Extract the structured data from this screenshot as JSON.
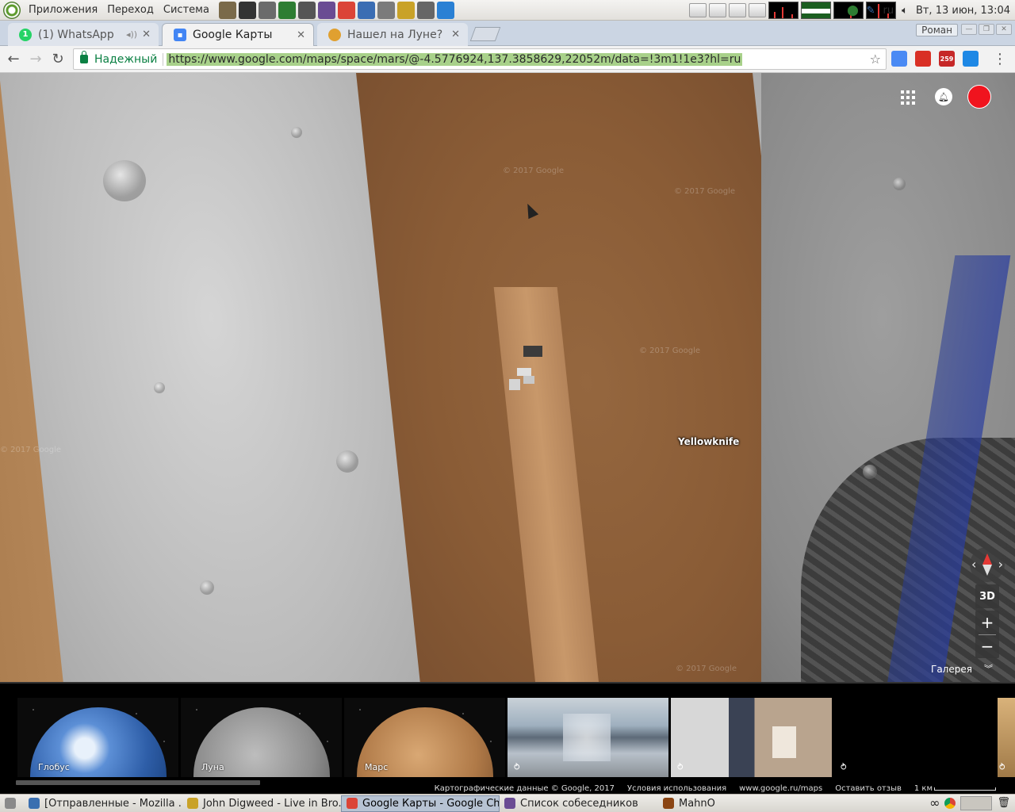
{
  "system_panel": {
    "menus": [
      "Приложения",
      "Переход",
      "Система"
    ],
    "launchers": [
      {
        "icon": "gimp-icon",
        "color": "#7a6a4a"
      },
      {
        "icon": "inkscape-icon",
        "color": "#333333"
      },
      {
        "icon": "archive-icon",
        "color": "#6b6b6b"
      },
      {
        "icon": "system-monitor-icon",
        "color": "#2e7d32"
      },
      {
        "icon": "calculator-icon",
        "color": "#555555"
      },
      {
        "icon": "pidgin-icon",
        "color": "#6a4c93"
      },
      {
        "icon": "chrome-icon",
        "color": "#db4437"
      },
      {
        "icon": "vpn-icon",
        "color": "#3b6db3"
      },
      {
        "icon": "tray-app-icon",
        "color": "#7b7b7b"
      },
      {
        "icon": "notes-icon",
        "color": "#c9a227"
      },
      {
        "icon": "scanner-icon",
        "color": "#666666"
      },
      {
        "icon": "chart-app-icon",
        "color": "#2a80d4"
      }
    ],
    "keyboard_layout": "ru",
    "datetime": "Вт, 13 июн, 13:04"
  },
  "tabs": [
    {
      "label": "(1) WhatsApp",
      "favicon": "whatsapp-icon",
      "color": "#25d366",
      "badge": "1",
      "state": "inactive"
    },
    {
      "label": "Google Карты",
      "favicon": "google-maps-icon",
      "color": "#4285f4",
      "state": "active"
    },
    {
      "label": "Нашел на Луне? Кт",
      "favicon": "page-icon",
      "color": "#e0a030",
      "state": "inactive"
    }
  ],
  "profile_name": "Роман",
  "omnibox": {
    "secure_label": "Надежный",
    "url": "https://www.google.com/maps/space/mars/@-4.5776924,137.3858629,22052m/data=!3m1!1e3?hl=ru"
  },
  "extensions": [
    {
      "icon": "extension-blue-icon",
      "color": "#4a8af4"
    },
    {
      "icon": "gmail-icon",
      "color": "#d93025"
    },
    {
      "icon": "calendar-badge-icon",
      "color": "#c62828",
      "badge": "259"
    },
    {
      "icon": "drive-icon",
      "color": "#1e88e5"
    }
  ],
  "map": {
    "place_label": "Yellowknife",
    "watermark": "© 2017 Google",
    "accent_red": "#f0141e"
  },
  "map_controls": {
    "btn_3d": "3D",
    "zoom_in": "+",
    "zoom_out": "−",
    "gallery_label": "Галерея"
  },
  "gallery": {
    "items": [
      {
        "label": "Глобус",
        "kind": "planet",
        "icon": "earth-icon"
      },
      {
        "label": "Луна",
        "kind": "planet",
        "icon": "moon-icon"
      },
      {
        "label": "Марс",
        "kind": "planet",
        "icon": "mars-icon"
      },
      {
        "label": "",
        "kind": "panorama",
        "icon": "panorama-icon"
      },
      {
        "label": "",
        "kind": "panorama",
        "icon": "panorama-icon"
      },
      {
        "label": "",
        "kind": "panorama",
        "icon": "panorama-icon"
      }
    ],
    "attribution": "Картографические данные © Google, 2017",
    "terms": "Условия использования",
    "site": "www.google.ru/maps",
    "feedback": "Оставить отзыв",
    "scale": "1 км"
  },
  "taskbar": {
    "items": [
      {
        "label": "[Отправленные - Mozilla ...",
        "icon": "thunderbird-icon",
        "color": "#3a6fb0",
        "active": false
      },
      {
        "label": "John Digweed - Live in Bro...",
        "icon": "audio-player-icon",
        "color": "#c9a227",
        "active": false
      },
      {
        "label": "Google Карты - Google Ch...",
        "icon": "chrome-icon",
        "color": "#db4437",
        "active": true
      },
      {
        "label": "Список собеседников",
        "icon": "pidgin-icon",
        "color": "#6a4c93",
        "active": false
      },
      {
        "label": "MahnO",
        "icon": "terminal-icon",
        "color": "#8b4513",
        "active": false
      }
    ]
  }
}
